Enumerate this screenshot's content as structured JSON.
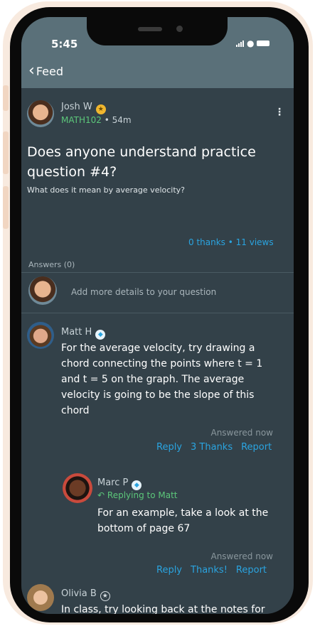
{
  "status_bar": {
    "time": "5:45"
  },
  "nav": {
    "back_label": "Feed"
  },
  "question": {
    "author": "Josh W",
    "course": "MATH102",
    "age": "54m",
    "title": "Does anyone understand practice question #4?",
    "body": "What does it mean by average velocity?",
    "thanks": "0 thanks",
    "views": "11 views"
  },
  "answers_header": "Answers (0)",
  "add_details_placeholder": "Add more details to your question",
  "answers": [
    {
      "author": "Matt H",
      "text": "For the average velocity, try drawing a chord connecting the points where t = 1 and t = 5 on the graph. The average velocity is going to be the slope of this chord",
      "answered": "Answered now",
      "reply_label": "Reply",
      "thanks_label": "3 Thanks",
      "report_label": "Report"
    },
    {
      "author": "Marc P",
      "replying_to": "Replying to Matt",
      "text": "For an example, take a look at the bottom of page 67",
      "answered": "Answered now",
      "reply_label": "Reply",
      "thanks_label": "Thanks!",
      "report_label": "Report"
    },
    {
      "author": "Olivia B",
      "text": "In class, try looking back at the notes for"
    }
  ],
  "colors": {
    "accent": "#2aa4e0",
    "course": "#5cc77a",
    "background": "#334149",
    "header": "#5a7079"
  }
}
